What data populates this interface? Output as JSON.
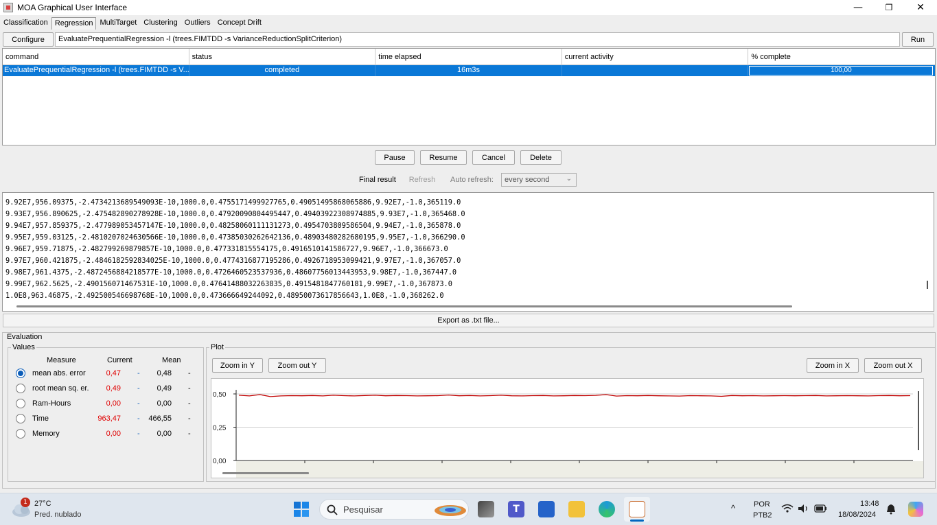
{
  "window": {
    "title": "MOA Graphical User Interface",
    "minimize_glyph": "—",
    "maximize_glyph": "❐",
    "close_glyph": "✕"
  },
  "tabs": [
    "Classification",
    "Regression",
    "MultiTarget",
    "Clustering",
    "Outliers",
    "Concept Drift"
  ],
  "active_tab": "Regression",
  "toolbar": {
    "configure_label": "Configure",
    "command": "EvaluatePrequentialRegression -l (trees.FIMTDD -s VarianceReductionSplitCriterion)",
    "run_label": "Run"
  },
  "task_table": {
    "headers": [
      "command",
      "status",
      "time elapsed",
      "current activity",
      "% complete"
    ],
    "row": {
      "command": "EvaluatePrequentialRegression -l (trees.FIMTDD -s V...",
      "status": "completed",
      "time_elapsed": "16m3s",
      "current_activity": "",
      "percent_complete": "100,00",
      "progress_fraction": 1.0
    }
  },
  "task_controls": {
    "pause": "Pause",
    "resume": "Resume",
    "cancel": "Cancel",
    "delete": "Delete",
    "final_result": "Final result",
    "refresh": "Refresh",
    "auto_refresh_label": "Auto refresh:",
    "auto_refresh_value": "every second"
  },
  "output_lines": [
    "9.92E7,956.09375,-2.4734213689549093E-10,1000.0,0.4755171499927765,0.49051495868065886,9.92E7,-1.0,365119.0",
    "9.93E7,956.890625,-2.4754828902789​28E-10,1000.0,0.47920090804495447,0.49403922308974885,9.93E7,-1.0,365468.0",
    "9.94E7,957.859375,-2.477989053457147E-10,1000.0,0.48258060111131273,0.4954703809586504,9.94E7,-1.0,365878.0",
    "9.95E7,959.03125,-2.481020702463056​6E-10,1000.0,0.47385030262642136,0.48903480282680195,9.95E7,-1.0,366290.0",
    "9.96E7,959.71875,-2.482799269879857E-10,1000.0,0.477331815554175,0.4916510141586727,9.96E7,-1.0,366673.0",
    "9.97E7,960.421875,-2.4846182592834025E-10,1000.0,0.47743168771952​86,0.4926718953099421,9.97E7,-1.0,367057.0",
    "9.98E7,961.4375,-2.4872456884218577E-10,1000.0,0.4726460523537936,0.48607756013443953,9.98E7,-1.0,367447.0",
    "9.99E7,962.5625,-2.490156071467531E-10,1000.0,0.4764148803226383​5,0.4915481847760181,9.99E7,-1.0,367873.0",
    "1.0E8,963.46875,-2.492500546698768E-10,1000.0,0.473666649244092,0.48950073617856643,1.0E8,-1.0,368262.0"
  ],
  "export_label": "Export as .txt file...",
  "evaluation": {
    "title": "Evaluation",
    "values_title": "Values",
    "headers": {
      "measure": "Measure",
      "current": "Current",
      "mean": "Mean"
    },
    "measures": [
      {
        "name": "mean abs. error",
        "current": "0,47",
        "mean": "0,48",
        "selected": true
      },
      {
        "name": "root mean sq. er.",
        "current": "0,49",
        "mean": "0,49",
        "selected": false
      },
      {
        "name": "Ram-Hours",
        "current": "0,00",
        "mean": "0,00",
        "selected": false
      },
      {
        "name": "Time",
        "current": "963,47",
        "mean": "466,55",
        "selected": false
      },
      {
        "name": "Memory",
        "current": "0,00",
        "mean": "0,00",
        "selected": false
      }
    ],
    "dash": "-",
    "current_color": "#e00000",
    "dash_color": "#0a5cb8"
  },
  "plot": {
    "title": "Plot",
    "zoom_in_y": "Zoom in Y",
    "zoom_out_y": "Zoom out Y",
    "zoom_in_x": "Zoom in X",
    "zoom_out_x": "Zoom out X"
  },
  "chart_data": {
    "type": "line",
    "y_ticks": [
      "0,50",
      "0,25",
      "0,00"
    ],
    "ylim": [
      0,
      0.5
    ],
    "series": [
      {
        "values": [
          0.49,
          0.485,
          0.495,
          0.48,
          0.485,
          0.487,
          0.486,
          0.488,
          0.485,
          0.49,
          0.487,
          0.485,
          0.488,
          0.49,
          0.486,
          0.488,
          0.487,
          0.485,
          0.486,
          0.487,
          0.492,
          0.486,
          0.488,
          0.485,
          0.487,
          0.49,
          0.486,
          0.485,
          0.487,
          0.488,
          0.485,
          0.486,
          0.488,
          0.487,
          0.489,
          0.495,
          0.484,
          0.487,
          0.486,
          0.488,
          0.486,
          0.485,
          0.484,
          0.487,
          0.486,
          0.485,
          0.482,
          0.488,
          0.486,
          0.487,
          0.485,
          0.486,
          0.487,
          0.486,
          0.487,
          0.488,
          0.485,
          0.486,
          0.487,
          0.486,
          0.485,
          0.487,
          0.488,
          0.486,
          0.487
        ],
        "color": "#c00000"
      }
    ]
  },
  "taskbar": {
    "weather_badge": "1",
    "temperature": "27°C",
    "weather_desc": "Pred. nublado",
    "search_placeholder": "Pesquisar",
    "lang1": "POR",
    "lang2": "PTB2",
    "time": "13:48",
    "date": "18/08/2024"
  }
}
